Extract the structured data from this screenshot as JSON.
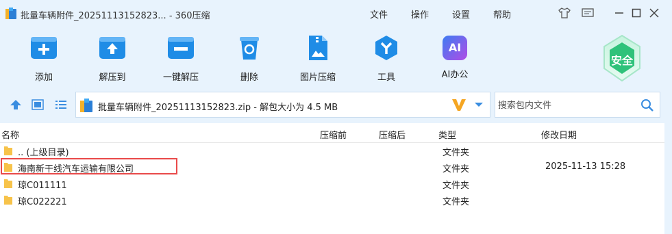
{
  "window": {
    "title": "批量车辆附件_20251113152823... - 360压缩",
    "menu": [
      "文件",
      "操作",
      "设置",
      "帮助"
    ]
  },
  "toolbar": {
    "items": [
      {
        "label": "添加",
        "icon": "add-icon"
      },
      {
        "label": "解压到",
        "icon": "extract-to-icon"
      },
      {
        "label": "一键解压",
        "icon": "one-click-extract-icon"
      },
      {
        "label": "删除",
        "icon": "delete-icon"
      },
      {
        "label": "图片压缩",
        "icon": "image-compress-icon"
      },
      {
        "label": "工具",
        "icon": "tools-icon"
      },
      {
        "label": "AI办公",
        "icon": "ai-office-icon"
      }
    ],
    "ai_text": "AI",
    "security_badge": "安全"
  },
  "address": {
    "path": "批量车辆附件_20251113152823.zip - 解包大小为 4.5 MB",
    "search_placeholder": "搜索包内文件"
  },
  "list": {
    "headers": {
      "name": "名称",
      "compressed": "压缩前",
      "after": "压缩后",
      "type": "类型",
      "modified": "修改日期"
    },
    "rows": [
      {
        "name": ".. (上级目录)",
        "type": "文件夹",
        "modified": ""
      },
      {
        "name": "海南新干线汽车运输有限公司",
        "type": "文件夹",
        "modified": "2025-11-13 15:28"
      },
      {
        "name": "琼C011111",
        "type": "文件夹",
        "modified": ""
      },
      {
        "name": "琼C022221",
        "type": "文件夹",
        "modified": ""
      }
    ]
  },
  "colors": {
    "accent": "#1f8ce6",
    "highlight": "#e94a4a",
    "background": "#e8f3fd"
  }
}
